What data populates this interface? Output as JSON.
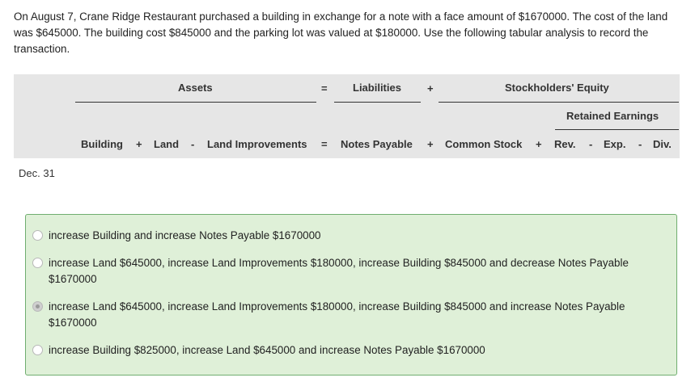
{
  "question": "On August 7, Crane Ridge Restaurant purchased a building in exchange for a note with a face amount of $1670000. The cost of the land was $645000. The building cost $845000 and the parking lot was valued at $180000. Use the following tabular analysis to record the transaction.",
  "table": {
    "headers": {
      "assets": "Assets",
      "eq1": "=",
      "liabilities": "Liabilities",
      "plus1": "+",
      "equity": "Stockholders' Equity",
      "retained": "Retained Earnings"
    },
    "columns": {
      "building": "Building",
      "plus_a": "+",
      "land": "Land",
      "minus_a": "-",
      "land_improvements": "Land Improvements",
      "eq2": "=",
      "notes_payable": "Notes Payable",
      "plus_b": "+",
      "common_stock": "Common Stock",
      "plus_c": "+",
      "rev": "Rev.",
      "minus_b": "-",
      "exp": "Exp.",
      "minus_c": "-",
      "div": "Div."
    },
    "row_label": "Dec. 31"
  },
  "options": [
    {
      "text": "increase Building and increase Notes Payable $1670000",
      "selected": false
    },
    {
      "text": "increase Land $645000, increase Land Improvements $180000, increase Building $845000 and decrease Notes Payable $1670000",
      "selected": false
    },
    {
      "text": "increase Land $645000, increase Land Improvements $180000, increase Building $845000 and increase Notes Payable $1670000",
      "selected": true
    },
    {
      "text": "increase Building $825000, increase Land $645000 and increase Notes Payable $1670000",
      "selected": false
    }
  ]
}
